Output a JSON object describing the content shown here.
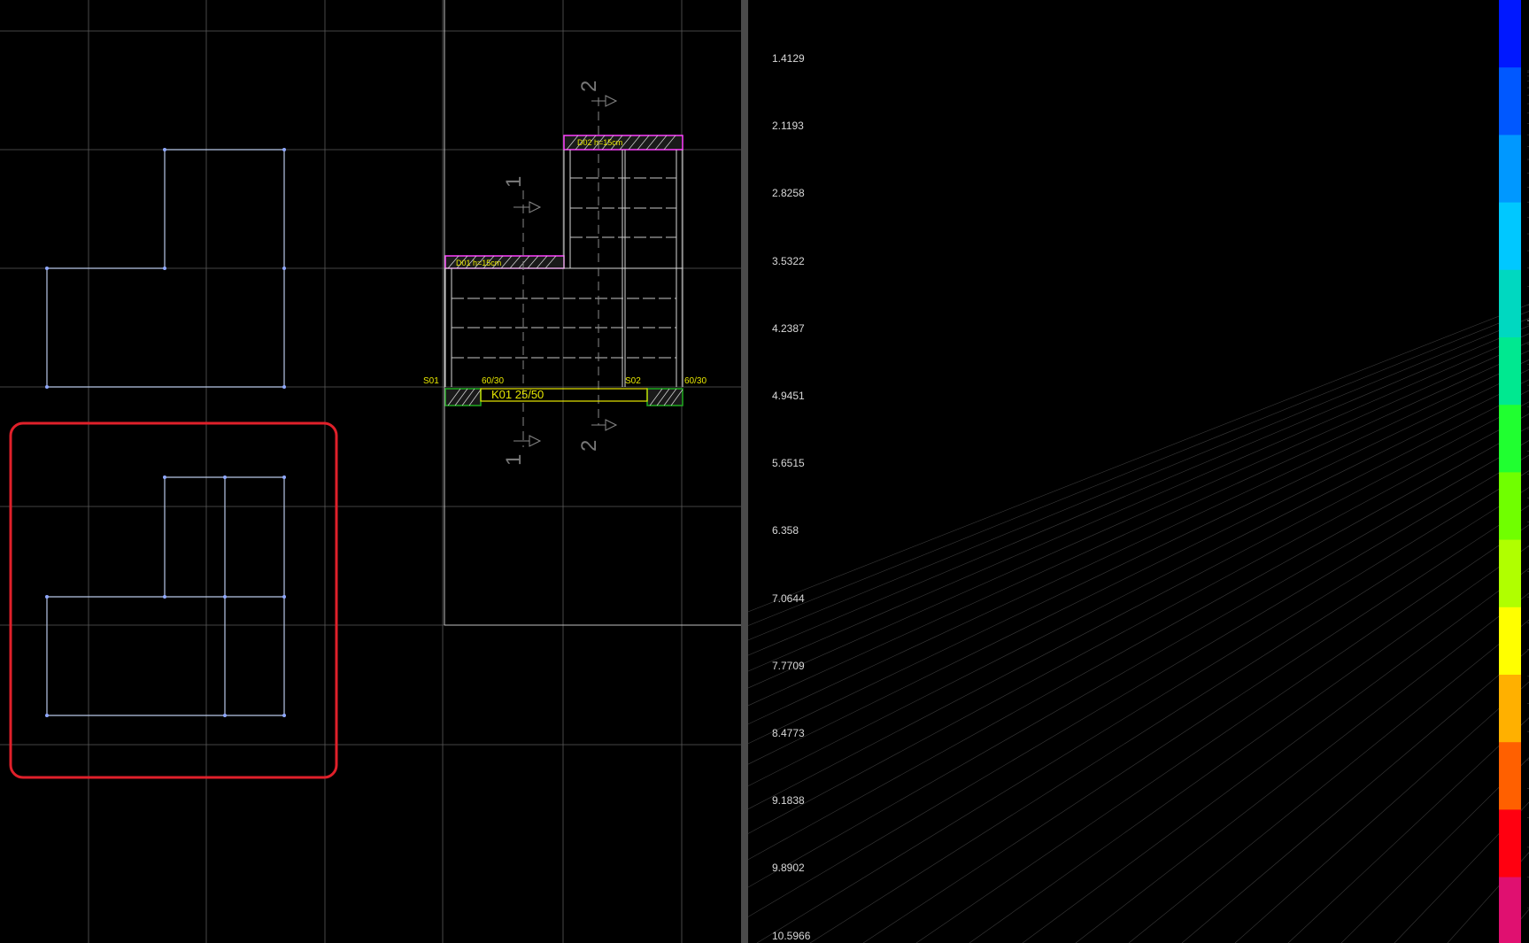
{
  "plan_view": {
    "grid_color": "#5a5a5a",
    "outline_color": "#b8c8e8",
    "selection_color": "#e0202a",
    "beam_label": "K01 25/50",
    "column_labels": [
      "S01",
      "S02"
    ],
    "column_size_labels": [
      "60/30",
      "60/30"
    ],
    "section_labels": [
      "1",
      "1",
      "2",
      "2"
    ],
    "slab_labels": [
      "D01 h=15cm",
      "D02 h=15cm"
    ]
  },
  "contour_legend": {
    "values": [
      "1.4129",
      "2.1193",
      "2.8258",
      "3.5322",
      "4.2387",
      "4.9451",
      "5.6515",
      "6.358",
      "7.0644",
      "7.7709",
      "8.4773",
      "9.1838",
      "9.8902",
      "10.5966"
    ],
    "colors": [
      "#0018ff",
      "#0058ff",
      "#0098ff",
      "#00c8ff",
      "#00d8c0",
      "#00e890",
      "#20ff30",
      "#70ff00",
      "#b0ff00",
      "#ffff00",
      "#ffb000",
      "#ff6000",
      "#ff0010",
      "#e01070"
    ]
  },
  "view_3d": {
    "ground_grid_color": "#3a3a3a",
    "mesh_color": "#0a1a40",
    "support_color": "#1fa31f",
    "axis_color": "#b01818"
  }
}
